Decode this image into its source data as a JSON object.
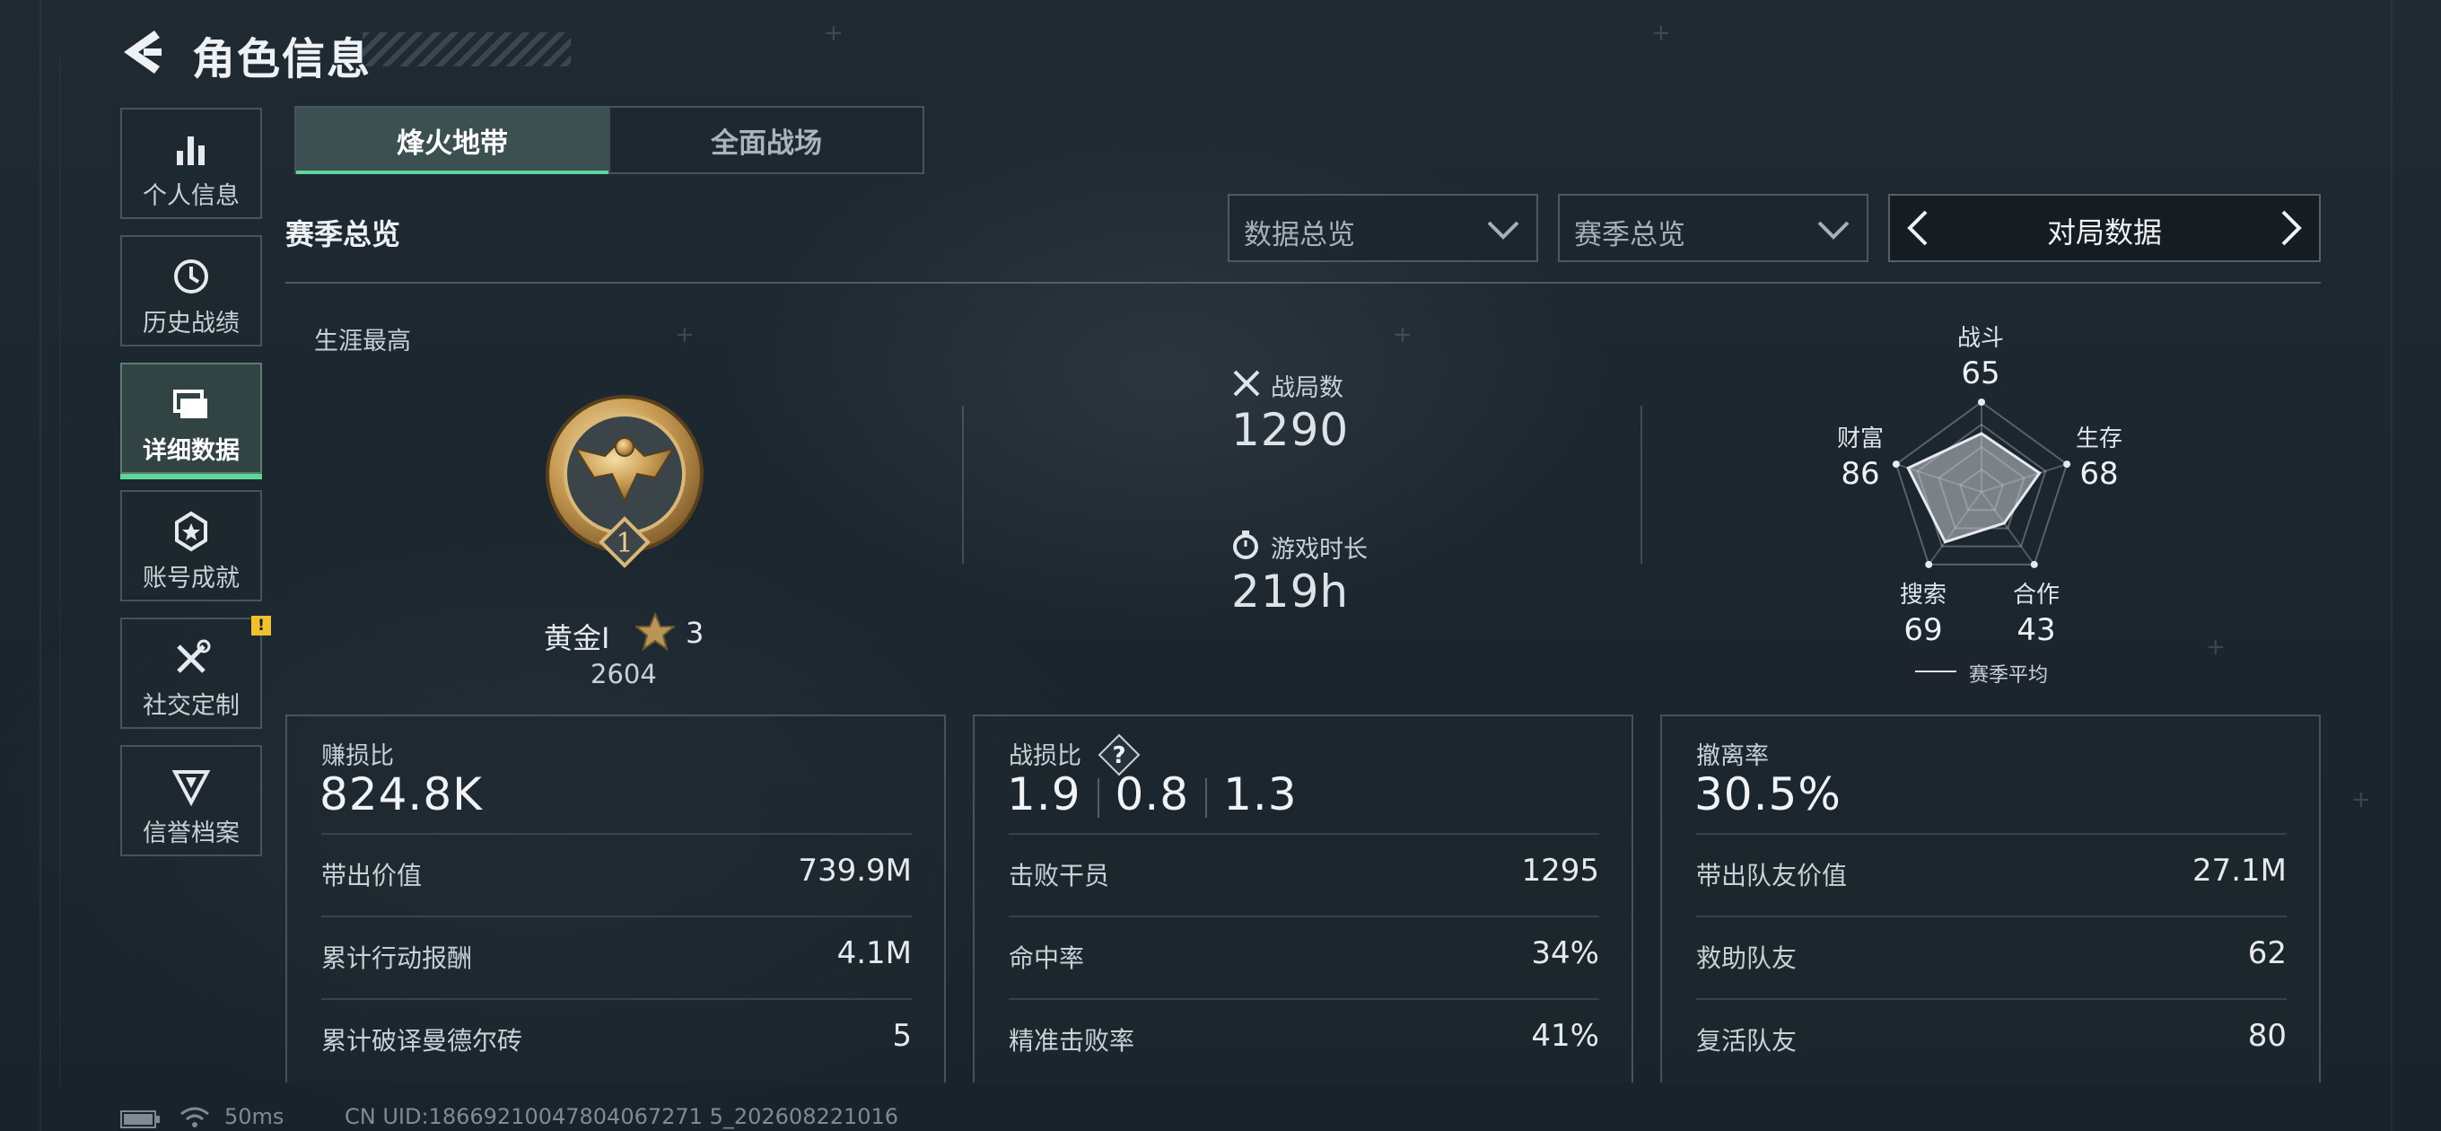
{
  "header": {
    "title": "角色信息"
  },
  "sidebar": {
    "items": [
      {
        "label": "个人信息",
        "icon": "bar-chart-icon"
      },
      {
        "label": "历史战绩",
        "icon": "history-icon"
      },
      {
        "label": "详细数据",
        "icon": "folders-icon",
        "active": true
      },
      {
        "label": "账号成就",
        "icon": "achievement-icon"
      },
      {
        "label": "社交定制",
        "icon": "tools-icon",
        "badge": "!"
      },
      {
        "label": "信誉档案",
        "icon": "reputation-icon"
      }
    ]
  },
  "tabs": [
    {
      "label": "烽火地带",
      "active": true
    },
    {
      "label": "全面战场"
    }
  ],
  "section_title": "赛季总览",
  "filters": {
    "data_scope": "数据总览",
    "season": "赛季总览",
    "match_selector": "对局数据"
  },
  "career": {
    "label": "生涯最高",
    "rank_name": "黄金I",
    "rank_stars": "3",
    "rank_score": "2604",
    "rank_tier": "1"
  },
  "overview": {
    "matches_label": "战局数",
    "matches_value": "1290",
    "playtime_label": "游戏时长",
    "playtime_value": "219h"
  },
  "radar": {
    "axes": [
      {
        "label": "战斗",
        "value": "65"
      },
      {
        "label": "生存",
        "value": "68"
      },
      {
        "label": "合作",
        "value": "43"
      },
      {
        "label": "搜索",
        "value": "69"
      },
      {
        "label": "财富",
        "value": "86"
      }
    ],
    "values": [
      65,
      68,
      43,
      69,
      86
    ],
    "legend": "赛季平均"
  },
  "panels": {
    "profit": {
      "title": "赚损比",
      "value": "824.8K",
      "rows": [
        {
          "k": "带出价值",
          "v": "739.9M"
        },
        {
          "k": "累计行动报酬",
          "v": "4.1M"
        },
        {
          "k": "累计破译曼德尔砖",
          "v": "5"
        }
      ]
    },
    "kd": {
      "title": "战损比",
      "help": "?",
      "values": [
        "1.9",
        "0.8",
        "1.3"
      ],
      "rows": [
        {
          "k": "击败干员",
          "v": "1295"
        },
        {
          "k": "命中率",
          "v": "34%"
        },
        {
          "k": "精准击败率",
          "v": "41%"
        }
      ]
    },
    "extract": {
      "title": "撤离率",
      "value": "30.5%",
      "rows": [
        {
          "k": "带出队友价值",
          "v": "27.1M"
        },
        {
          "k": "救助队友",
          "v": "62"
        },
        {
          "k": "复活队友",
          "v": "80"
        }
      ]
    }
  },
  "footer": {
    "ping": "50ms",
    "uid": "CN UID:18669210047804067271 5_202608221016"
  },
  "colors": {
    "accent": "#5fd59a",
    "badge": "#f0c02f"
  }
}
